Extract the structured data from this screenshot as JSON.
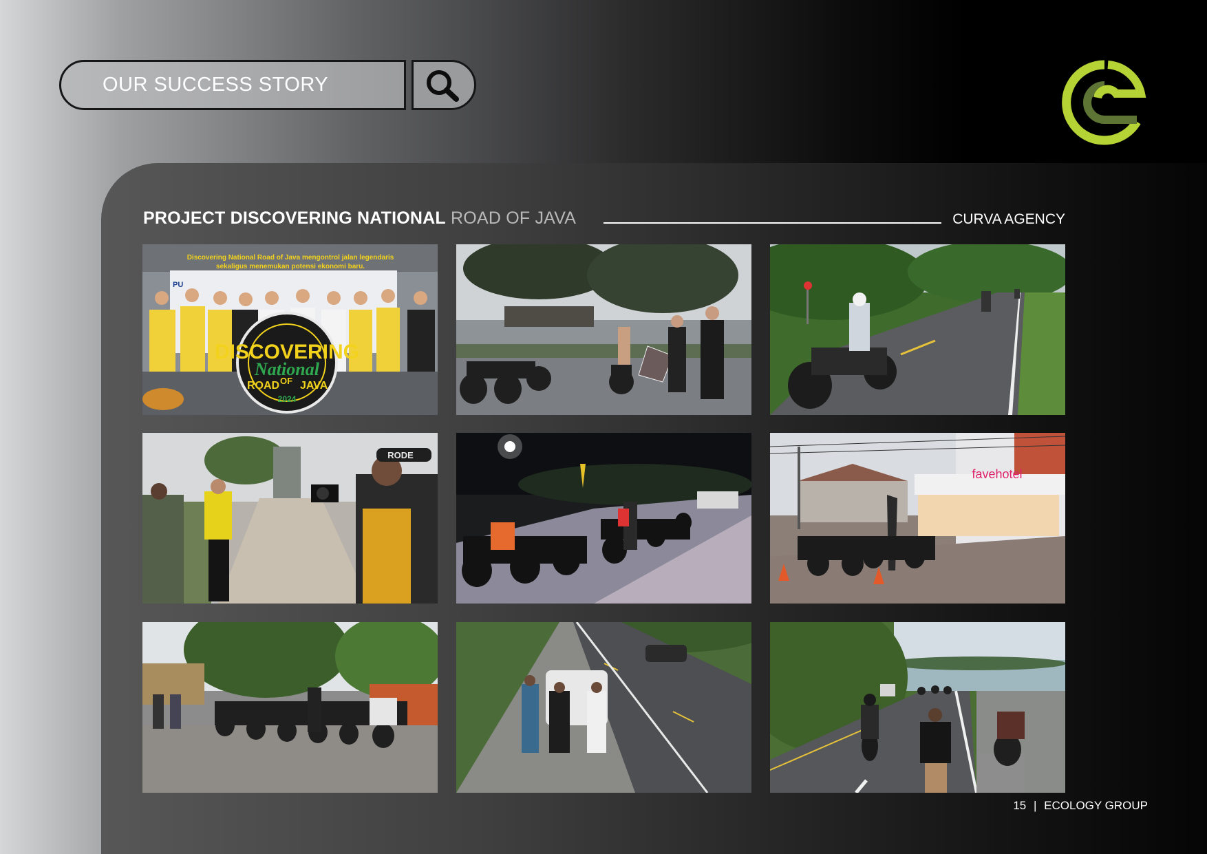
{
  "header": {
    "search_label": "OUR SUCCESS STORY"
  },
  "project": {
    "title_bold": "PROJECT DISCOVERING NATIONAL",
    "title_light": "ROAD OF JAVA",
    "agency": "CURVA AGENCY"
  },
  "photo1": {
    "caption_line1": "Discovering National Road of Java mengontrol jalan legendaris",
    "caption_line2": "sekaligus menemukan potensi ekonomi baru.",
    "emblem_line1": "DISCOVERING",
    "emblem_line2": "National",
    "emblem_road": "ROAD",
    "emblem_of": "OF",
    "emblem_java": "JAVA",
    "emblem_year": "2024",
    "backdrop_logo": "PU"
  },
  "photo4": {
    "mic_brand": "RODE"
  },
  "photo6": {
    "hotel_sign": "favehotel"
  },
  "footer": {
    "page_number": "15",
    "separator": "|",
    "company": "ECOLOGY GROUP"
  },
  "colors": {
    "logo_green": "#b5d334",
    "logo_dark_green": "#5d7434",
    "search_border": "#161616"
  },
  "icons": {
    "search": "magnifier-icon",
    "logo": "ecology-e-logo"
  }
}
